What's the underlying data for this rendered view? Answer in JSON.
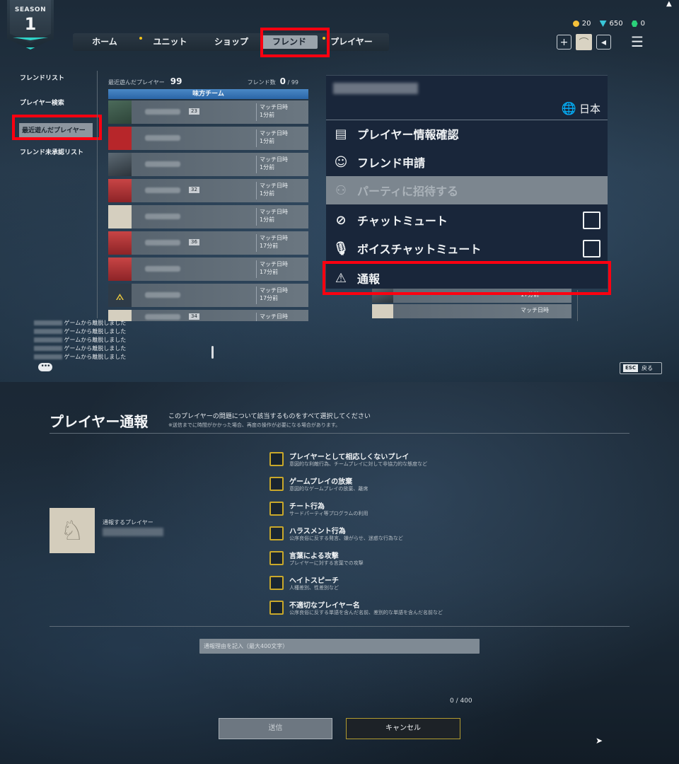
{
  "season": {
    "label": "SEASON",
    "number": "1"
  },
  "nav": {
    "tabs": [
      "ホーム",
      "ユニット",
      "ショップ",
      "フレンド",
      "プレイヤー"
    ],
    "active": "フレンド"
  },
  "currency": {
    "gold": "20",
    "gem": "650",
    "green": "0"
  },
  "side_menu": [
    "フレンドリスト",
    "プレイヤー検索",
    "最近遊んだプレイヤー",
    "フレンド未承認リスト"
  ],
  "list": {
    "recent_label": "最近遊んだプレイヤー",
    "recent_count": "99",
    "friends_label": "フレンド数",
    "friends_count": "0",
    "friends_max": "/ 99",
    "team": "味方チーム",
    "rows": [
      {
        "level": "23",
        "match_label": "マッチ日時",
        "ago": "1分前"
      },
      {
        "level": "",
        "match_label": "マッチ日時",
        "ago": "1分前"
      },
      {
        "level": "",
        "match_label": "マッチ日時",
        "ago": "1分前"
      },
      {
        "level": "32",
        "match_label": "マッチ日時",
        "ago": "1分前"
      },
      {
        "level": "",
        "match_label": "マッチ日時",
        "ago": "1分前"
      },
      {
        "level": "36",
        "match_label": "マッチ日時",
        "ago": "17分前"
      },
      {
        "level": "",
        "match_label": "マッチ日時",
        "ago": "17分前"
      },
      {
        "level": "",
        "match_label": "マッチ日時",
        "ago": "17分前"
      },
      {
        "level": "34",
        "match_label": "マッチ日時",
        "ago": ""
      }
    ]
  },
  "chat_log": [
    "ゲームから離脱しました",
    "ゲームから離脱しました",
    "ゲームから離脱しました",
    "ゲームから離脱しました",
    "ゲームから離脱しました"
  ],
  "esc": {
    "key": "ESC",
    "label": "戻る"
  },
  "popup": {
    "region": "日本",
    "options": [
      {
        "label": "プレイヤー情報確認"
      },
      {
        "label": "フレンド申請"
      },
      {
        "label": "パーティに招待する"
      },
      {
        "label": "チャットミュート"
      },
      {
        "label": "ボイスチャットミュート"
      },
      {
        "label": "通報"
      }
    ],
    "under_rows": [
      {
        "ago": "17分前"
      },
      {
        "ago": "マッチ日時"
      }
    ]
  },
  "report": {
    "title": "プレイヤー通報",
    "description": "このプレイヤーの問題について該当するものをすべて選択してください",
    "note": "※送信までに時間がかかった場合、再度の操作が必要になる場合があります。",
    "target_label": "通報するプレイヤー",
    "reasons": [
      {
        "title": "プレイヤーとして相応しくないプレイ",
        "sub": "意図的な利敵行為、チームプレイに対して非協力的な態度など"
      },
      {
        "title": "ゲームプレイの放棄",
        "sub": "意図的なゲームプレイの放棄、離席"
      },
      {
        "title": "チート行為",
        "sub": "サードパーティ等プログラムの利用"
      },
      {
        "title": "ハラスメント行為",
        "sub": "公序良俗に反する発言、嫌がらせ、迷惑な行為など"
      },
      {
        "title": "言葉による攻撃",
        "sub": "プレイヤーに対する言葉での攻撃"
      },
      {
        "title": "ヘイトスピーチ",
        "sub": "人種差別、性差別など"
      },
      {
        "title": "不適切なプレイヤー名",
        "sub": "公序良俗に反する単語を含んだ名前、差別的な単語を含んだ名前など"
      }
    ],
    "input_placeholder": "通報理由を記入（最大400文字）",
    "counter": "0 / 400",
    "send": "送信",
    "cancel": "キャンセル"
  }
}
